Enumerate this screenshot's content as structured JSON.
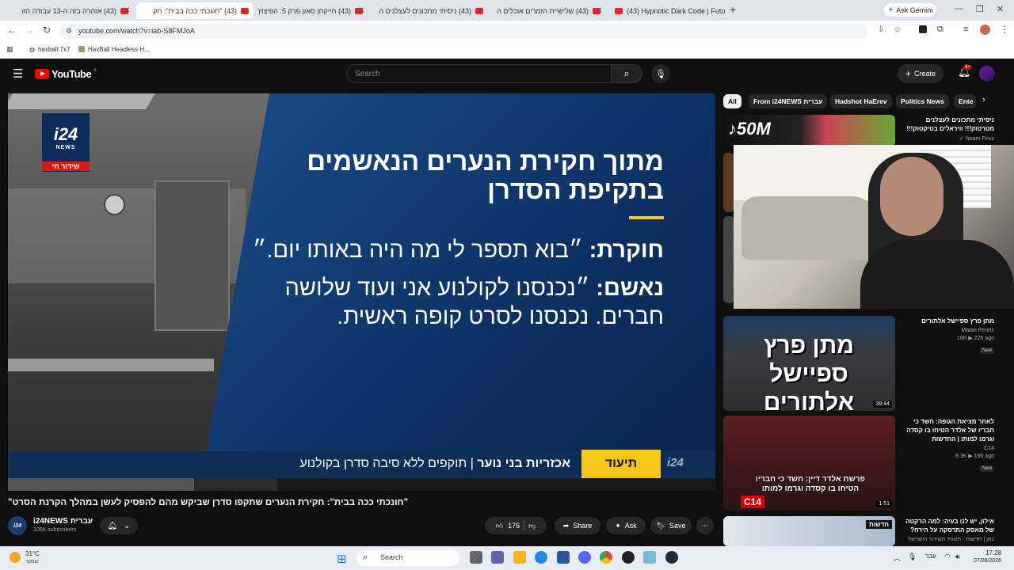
{
  "browser": {
    "tabs": [
      {
        "label": "(43) אזהרה בזה ה-13 עבודה הזהרה"
      },
      {
        "label": "(43) \"חוגכתי ככה בבית\": חק",
        "active": true
      },
      {
        "label": "(43) חייקחן סאון פרק 5: הפיצוץ"
      },
      {
        "label": "(43) ניסיתי מתכונים לעצלנים ה"
      },
      {
        "label": "(43) שלישיית הזמרים אוכלים ה"
      },
      {
        "label": "(43) Hypnotic Dark Code | Futu"
      }
    ],
    "ask_gemini": "Ask Gemini",
    "url": "youtube.com/watch?v=iab-S8FMJoA",
    "bookmarks": [
      "haxball 7x7",
      "HaxBall Headless H..."
    ]
  },
  "youtube": {
    "logo": "YouTube",
    "country": "IL",
    "search_placeholder": "Search",
    "create": "Create",
    "notifications": "9+"
  },
  "video": {
    "panel_title": "מתוך חקירת הנערים הנאשמים בתקיפת הסדרן",
    "q1_label": "חוקרת:",
    "q1_text": " ״בוא תספר לי מה היה באותו יום.״",
    "q2_label": "נאשם:",
    "q2_text": " ״נכנסנו לקולנוע אני ועוד שלושה חברים. נכנסנו לסרט קופה ראשית.",
    "lower_bold": "אכזריות בני נוער",
    "lower_rest": " | תוקפים ללא סיבה סדרן בקולנוע",
    "yellow_tag": "תיעוד",
    "channel_logo": "i24",
    "channel_logo_sub": "NEWS",
    "live": "שידור חי",
    "bug": "i24"
  },
  "watch": {
    "title": "\"חונכתי ככה בבית\": חקירת הנערים שתקפו סדרן שביקש מהם להפסיק לעשן במהלך הקרנת הסרט\"",
    "channel": "i24NEWS עברית",
    "subs": "105K subscribers",
    "likes": "176",
    "share": "Share",
    "ask": "Ask",
    "save": "Save"
  },
  "chips": [
    "All",
    "From i24NEWS עברית",
    "Hadshot HaErev",
    "Politics News",
    "Ente"
  ],
  "sidebar": [
    {
      "title": "ניסיתי מתכונים לעצלנים מטרטוק!!! וויראלים בטיקטוק!!!",
      "channel": "Noam Firuz",
      "views": "",
      "age": "",
      "duration": "",
      "new": false
    },
    {
      "title": "מתן פרץ ספיישל אלתורים",
      "channel": "Matan Peretz",
      "views": "18K",
      "age": "22h ago",
      "duration": "39:44",
      "new": true
    },
    {
      "title": "לאחר מציאת הגופה: חשד כי חבריו של אלדר הטיחו בו קסדה וגרמו למותו | החדשות",
      "channel": "C14",
      "views": "8.3K",
      "age": "19h ago",
      "duration": "1:51",
      "new": true
    },
    {
      "title": "אילון, יש לנו בעיה: למה הרקטה של מאסק התרסקה על הירח?",
      "channel": "כאן | חדשות - תאגיד השידור הישראלי",
      "views": "",
      "age": "",
      "duration": "",
      "new": false
    }
  ],
  "thumb_text": {
    "tiktok": "50M",
    "matan": "מתן פרץ ספיישל אלתורים",
    "c14_overlay": "פרשת אלדר דיין: חשד כי חבריו הטיחו בו קסדה וגרמו למותו",
    "c14": "C14",
    "kan": "חדשות"
  },
  "taskbar": {
    "weather_temp": "31°C",
    "weather_desc": "שמשי",
    "search": "Search",
    "lang": "עבר",
    "time": "17:28",
    "date": "07/08/2026"
  }
}
